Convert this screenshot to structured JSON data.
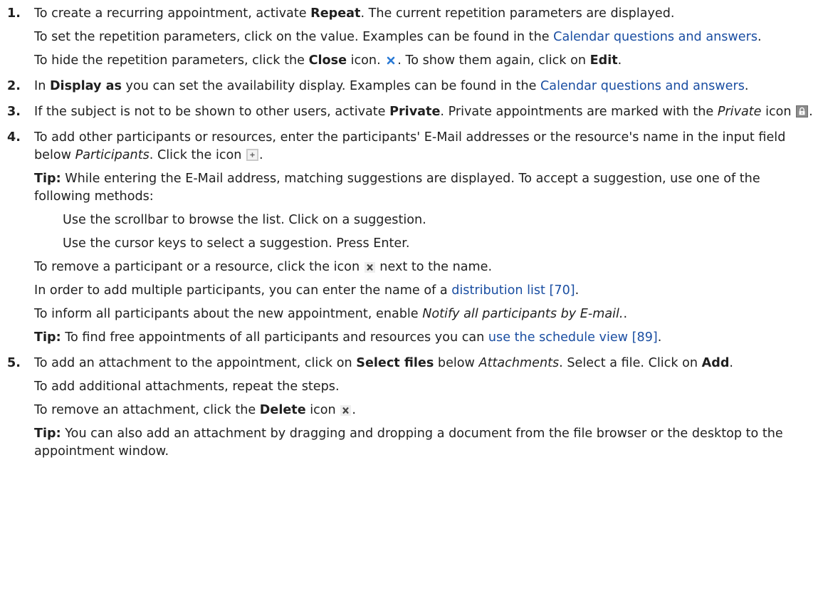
{
  "steps": [
    {
      "num": "1.",
      "p1_a": "To create a recurring appointment, activate ",
      "p1_b": "Repeat",
      "p1_c": ". The current repetition parameters are displayed.",
      "p2_a": "To set the repetition parameters, click on the value. Examples can be found in the ",
      "p2_link": "Calendar questions and answers",
      "p2_c": ".",
      "p3_a": "To hide the repetition parameters, click the ",
      "p3_b": "Close",
      "p3_c": " icon. ",
      "p3_d": ". To show them again, click on ",
      "p3_e": "Edit",
      "p3_f": "."
    },
    {
      "num": "2.",
      "a": "In ",
      "b": "Display as",
      "c": " you can set the availability display. Examples can be found in the ",
      "link": "Calendar questions and answers",
      "d": "."
    },
    {
      "num": "3.",
      "a": "If the subject is not to be shown to other users, activate ",
      "b": "Private",
      "c": ". Private appointments are marked with the ",
      "d": "Private",
      "e": " icon ",
      "f": "."
    },
    {
      "num": "4.",
      "p1_a": "To add other participants or resources, enter the participants' E-Mail addresses or the resource's name in the input field below ",
      "p1_b": "Participants",
      "p1_c": ". Click the icon ",
      "p1_d": ".",
      "tip1_label": "Tip:",
      "tip1_text": " While entering the E-Mail address, matching suggestions are displayed. To accept a suggestion, use one of the following methods:",
      "sub1": "Use the scrollbar to browse the list. Click on a suggestion.",
      "sub2": "Use the cursor keys to select a suggestion. Press Enter.",
      "p_remove_a": "To remove a participant or a resource, click the icon ",
      "p_remove_b": " next to the name.",
      "p_multi_a": "In order to add multiple participants, you can enter the name of a ",
      "p_multi_link": "distribution list [70]",
      "p_multi_c": ".",
      "p_notify_a": "To inform all participants about the new appointment, enable ",
      "p_notify_b": "Notify all participants by E-mail.",
      "p_notify_c": ".",
      "tip2_label": "Tip:",
      "tip2_text": " To find free appointments of all participants and resources you can ",
      "tip2_link": "use the schedule view [89]",
      "tip2_end": "."
    },
    {
      "num": "5.",
      "p1_a": "To add an attachment to the appointment, click on ",
      "p1_b": "Select files",
      "p1_c": " below ",
      "p1_d": "Attachments",
      "p1_e": ". Select a file. Click on ",
      "p1_f": "Add",
      "p1_g": ".",
      "p2": "To add additional attachments, repeat the steps.",
      "p3_a": "To remove an attachment, click the ",
      "p3_b": "Delete",
      "p3_c": " icon ",
      "p3_d": ".",
      "tip_label": "Tip:",
      "tip_text": " You can also add an attachment by dragging and dropping a document from the file browser or the desktop to the appointment window."
    }
  ],
  "icons": {
    "close": "close-icon",
    "private": "lock-icon",
    "add": "plus-icon",
    "remove": "x-icon",
    "delete": "delete-icon"
  },
  "colors": {
    "text": "#1f1f1f",
    "link": "#1a4ea2",
    "close_icon": "#2a7ad5"
  }
}
